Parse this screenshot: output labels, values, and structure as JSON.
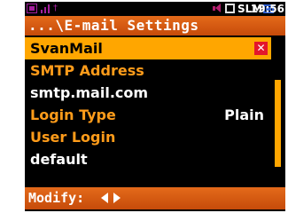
{
  "statusbar": {
    "mode": "SLM",
    "time": "19:56",
    "icons": [
      "memory-card-icon",
      "signal-bars-icon",
      "antenna-icon",
      "speaker-icon",
      "box-icon",
      "battery-icon"
    ]
  },
  "title": "...\\E-mail Settings",
  "menu": {
    "items": [
      {
        "label": "SvanMail",
        "value": "",
        "state": "selected"
      },
      {
        "label": "SMTP Address",
        "value": "",
        "state": "heading"
      },
      {
        "label": "smtp.mail.com",
        "value": "",
        "state": "plain"
      },
      {
        "label": "Login Type",
        "value": "Plain",
        "state": "heading"
      },
      {
        "label": "User Login",
        "value": "",
        "state": "heading"
      },
      {
        "label": "default",
        "value": "",
        "state": "plain"
      }
    ]
  },
  "footer": {
    "modify_label": "Modify:"
  },
  "colors": {
    "orange_accent": "#ffa600",
    "title_bar": "#e46a1a",
    "delete_red": "#e3162c"
  }
}
